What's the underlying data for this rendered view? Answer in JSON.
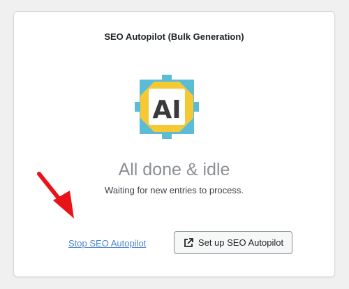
{
  "panel": {
    "title": "SEO Autopilot (Bulk Generation)",
    "status_heading": "All done & idle",
    "status_subtext": "Waiting for new entries to process."
  },
  "logo": {
    "text": "AI",
    "icon": "ai-logo-icon",
    "colors": {
      "square": "#5bbcd8",
      "octagon": "#f6c934",
      "badge_bg": "#ffffff",
      "badge_text": "#3a3a3a"
    }
  },
  "actions": {
    "stop_label": "Stop SEO Autopilot",
    "setup_label": "Set up SEO Autopilot",
    "setup_icon": "external-link-icon"
  },
  "annotation": {
    "icon": "red-arrow-icon",
    "color": "#e8141a"
  },
  "colors": {
    "link": "#4d86c9",
    "heading_muted": "#8c8f94",
    "text": "#1d2327"
  }
}
